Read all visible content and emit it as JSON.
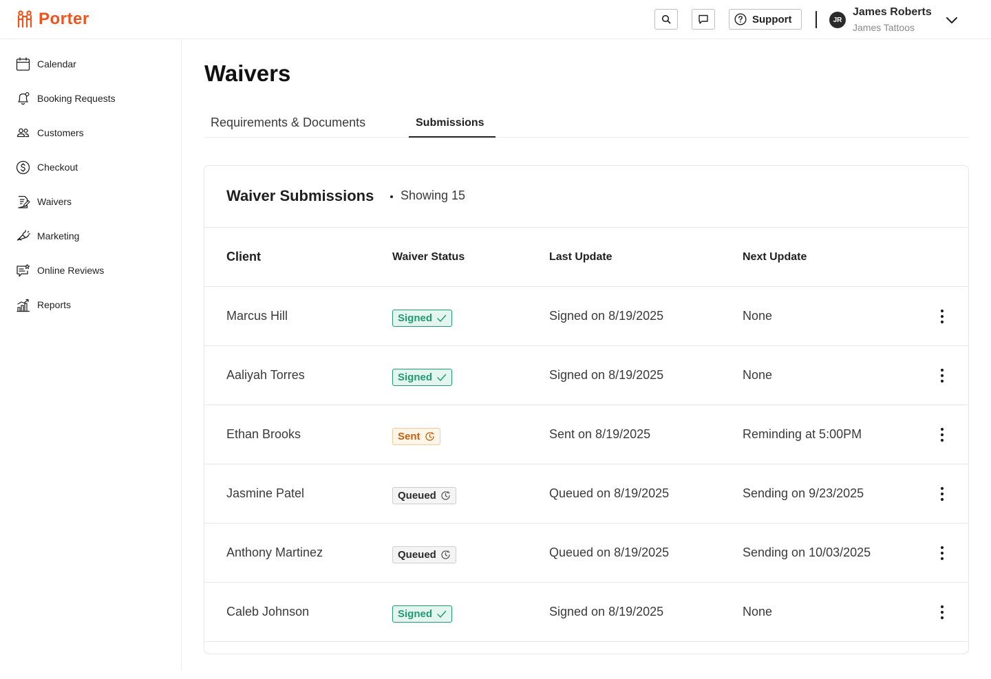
{
  "app": {
    "name": "Porter",
    "brand_color": "#f0531c"
  },
  "header": {
    "support_label": "Support",
    "user": {
      "initials": "JR",
      "name": "James Roberts",
      "business": "James Tattoos"
    }
  },
  "sidebar": {
    "items": [
      {
        "label": "Calendar",
        "icon": "calendar-icon"
      },
      {
        "label": "Booking Requests",
        "icon": "bell-icon"
      },
      {
        "label": "Customers",
        "icon": "users-icon"
      },
      {
        "label": "Checkout",
        "icon": "dollar-icon"
      },
      {
        "label": "Waivers",
        "icon": "document-edit-icon"
      },
      {
        "label": "Marketing",
        "icon": "megaphone-icon"
      },
      {
        "label": "Online Reviews",
        "icon": "review-icon"
      },
      {
        "label": "Reports",
        "icon": "bar-chart-icon"
      }
    ]
  },
  "page": {
    "title": "Waivers"
  },
  "tabs": [
    {
      "label": "Requirements & Documents",
      "active": false
    },
    {
      "label": "Submissions",
      "active": true
    }
  ],
  "card": {
    "title": "Waiver Submissions",
    "count_label": "Showing 15",
    "columns": [
      "Client",
      "Waiver Status",
      "Last Update",
      "Next Update"
    ],
    "rows": [
      {
        "client": "Marcus Hill",
        "status": "Signed",
        "status_kind": "signed",
        "last_update": "Signed on 8/19/2025",
        "next_update": "None"
      },
      {
        "client": "Aaliyah Torres",
        "status": "Signed",
        "status_kind": "signed",
        "last_update": "Signed on 8/19/2025",
        "next_update": "None"
      },
      {
        "client": "Ethan Brooks",
        "status": "Sent",
        "status_kind": "sent",
        "last_update": "Sent on 8/19/2025",
        "next_update": "Reminding at 5:00PM"
      },
      {
        "client": "Jasmine Patel",
        "status": "Queued",
        "status_kind": "queued",
        "last_update": "Queued on 8/19/2025",
        "next_update": "Sending on 9/23/2025"
      },
      {
        "client": "Anthony Martinez",
        "status": "Queued",
        "status_kind": "queued",
        "last_update": "Queued on 8/19/2025",
        "next_update": "Sending on 10/03/2025"
      },
      {
        "client": "Caleb Johnson",
        "status": "Signed",
        "status_kind": "signed",
        "last_update": "Signed on 8/19/2025",
        "next_update": "None"
      }
    ]
  },
  "colors": {
    "signed": "#1f9a72",
    "sent": "#c5600e",
    "queued": "#2b2b2b"
  }
}
